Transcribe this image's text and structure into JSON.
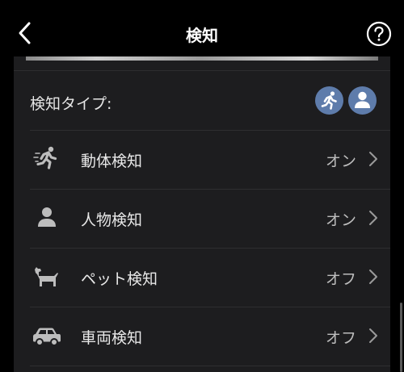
{
  "header": {
    "title": "検知"
  },
  "detection_type": {
    "label": "検知タイプ:",
    "active_icons": [
      "running-person-icon",
      "person-icon"
    ],
    "accent_color": "#5e7cab"
  },
  "items": [
    {
      "icon": "running-person-icon",
      "label": "動体検知",
      "value": "オン"
    },
    {
      "icon": "person-icon",
      "label": "人物検知",
      "value": "オン"
    },
    {
      "icon": "dog-icon",
      "label": "ペット検知",
      "value": "オフ"
    },
    {
      "icon": "car-icon",
      "label": "車両検知",
      "value": "オフ"
    }
  ]
}
